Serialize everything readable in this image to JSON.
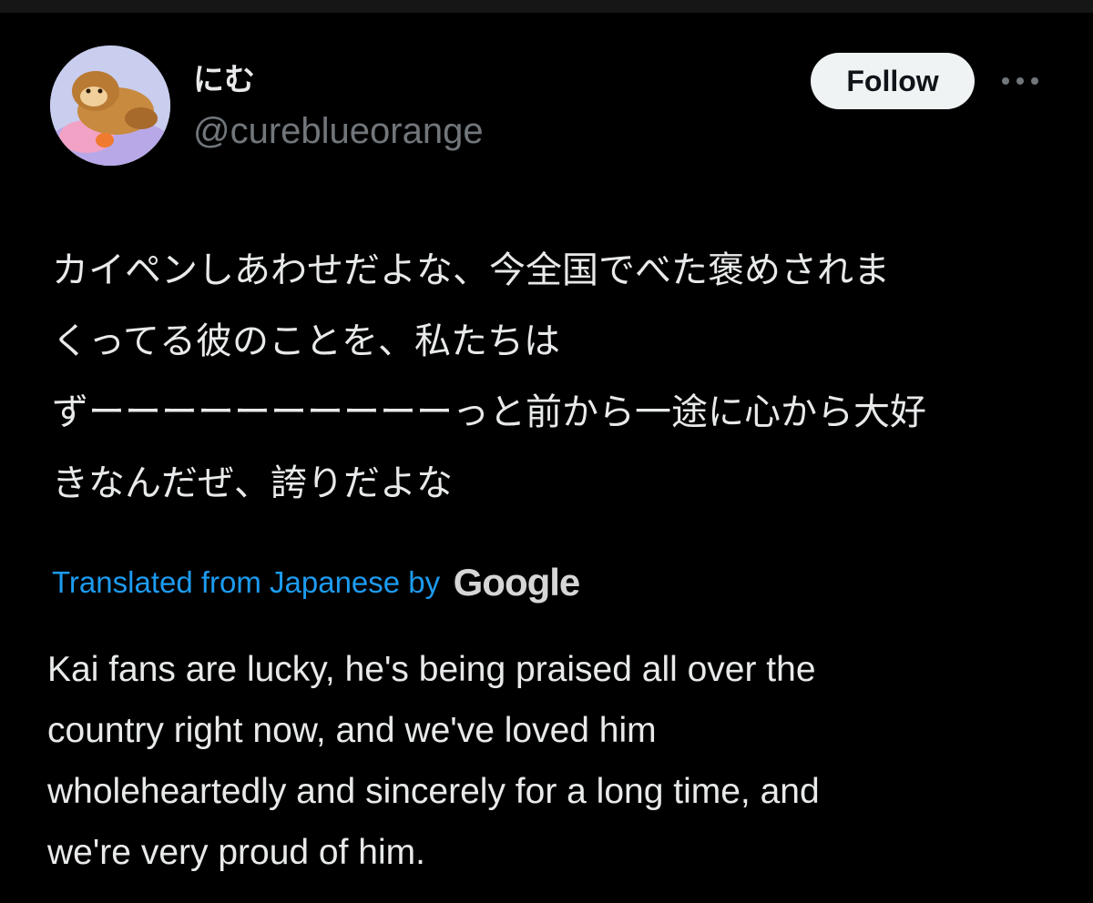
{
  "author": {
    "display_name": "にむ",
    "handle": "@cureblueorange"
  },
  "actions": {
    "follow_label": "Follow",
    "more_icon": "more-horizontal-icon"
  },
  "tweet": {
    "lines": [
      "カイペンしあわせだよな、今全国でべた褒めされま",
      "くってる彼のことを、私たちは",
      "ずーーーーーーーーーーっと前から一途に心から大好",
      "きなんだぜ、誇りだよな"
    ]
  },
  "translation": {
    "label": "Translated from Japanese by",
    "provider": "Google",
    "lines": [
      "Kai fans are lucky, he's being praised all over the",
      "country right now, and we've loved him",
      "wholeheartedly and sincerely for a long time, and",
      "we're very proud of him."
    ]
  },
  "colors": {
    "background": "#000000",
    "text_primary": "#e7e9ea",
    "text_secondary": "#71767b",
    "link": "#1d9bf0",
    "follow_bg": "#eff3f4"
  }
}
